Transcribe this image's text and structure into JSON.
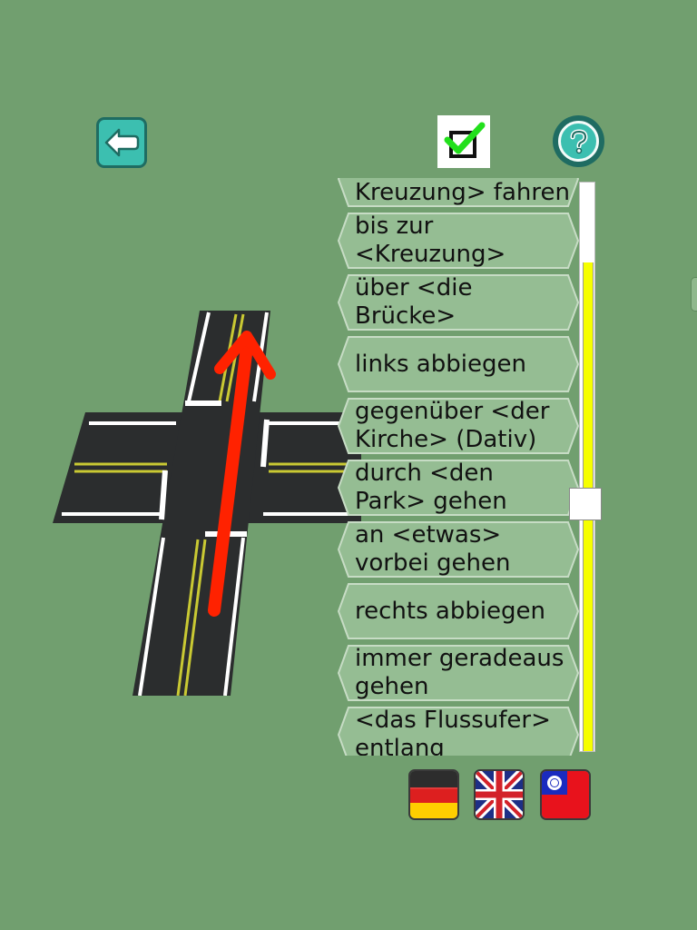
{
  "header": {
    "back_icon": "arrow-left-icon",
    "check_icon": "checkbox-checked-icon",
    "help_icon": "question-mark-icon",
    "accent_color": "#3cbfb0"
  },
  "illustration": {
    "icon": "crossroad-straight-arrow-icon",
    "arrow_color": "#ff2200"
  },
  "phrases": [
    "<über die Kreuzung> fahren",
    "bis zur\n<Kreuzung>",
    "über <die\nBrücke>",
    "links abbiegen",
    "gegenüber <der\nKirche> (Dativ)",
    "durch <den\nPark> gehen",
    "an <etwas>\nvorbei gehen",
    "rechts abbiegen",
    "immer geradeaus\ngehen",
    "<das Flussufer>\nentlang"
  ],
  "scrollbar": {
    "position_fraction": 0.57,
    "fill_color": "#f6ff00"
  },
  "languages": [
    {
      "name": "german-flag-icon",
      "code": "de"
    },
    {
      "name": "uk-flag-icon",
      "code": "en"
    },
    {
      "name": "taiwan-flag-icon",
      "code": "zh-TW"
    }
  ]
}
